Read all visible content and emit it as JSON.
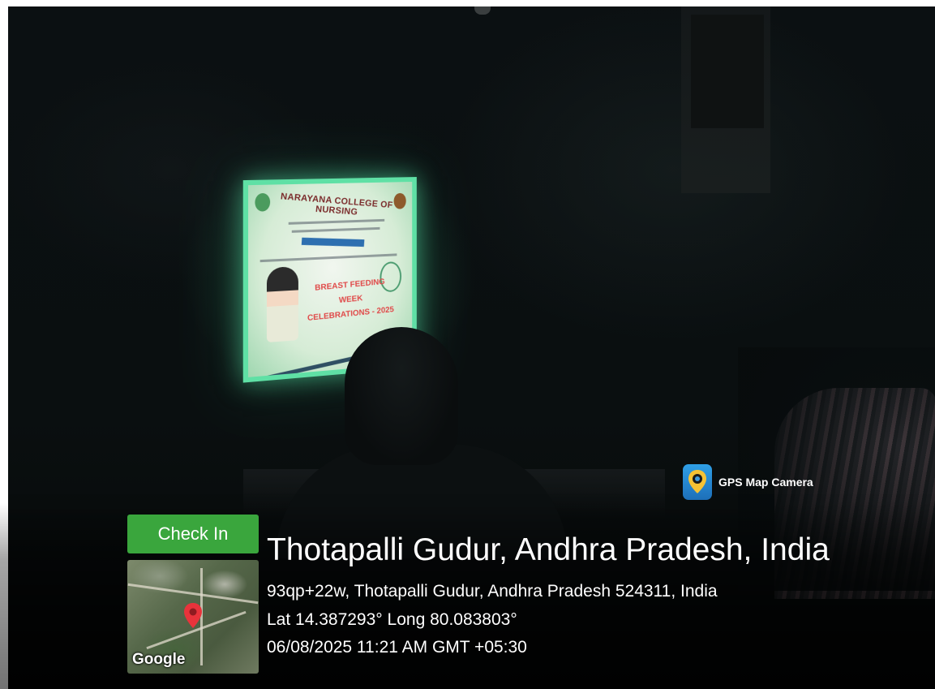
{
  "projection_slide": {
    "college_name": "NARAYANA COLLEGE OF NURSING",
    "headline_line1": "BREAST FEEDING WEEK",
    "headline_line2": "CELEBRATIONS - 2025"
  },
  "gps_overlay": {
    "app_label": "GPS Map Camera",
    "app_icon": "map-pin-camera-icon",
    "checkin_label": "Check In",
    "map_brand": "Google",
    "place": "Thotapalli Gudur, Andhra Pradesh, India",
    "address": "93qp+22w, Thotapalli Gudur, Andhra Pradesh 524311, India",
    "coordinates": "Lat 14.387293° Long 80.083803°",
    "timestamp": "06/08/2025 11:21 AM GMT +05:30",
    "checkin_color": "#3aa63d",
    "pin_color": "#e8333b"
  }
}
